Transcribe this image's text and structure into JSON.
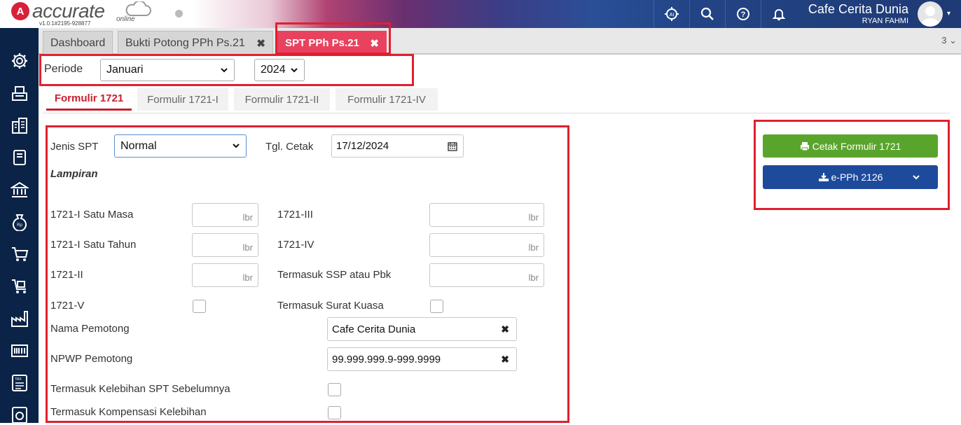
{
  "app": {
    "logo_letter": "A",
    "name": "accurate",
    "online": "online",
    "version": "v1.0.1#2195-928877"
  },
  "header": {
    "company": "Cafe Cerita Dunia",
    "user": "RYAN FAHMI",
    "icons": [
      "ai-icon",
      "search-icon",
      "help-icon",
      "bell-icon"
    ]
  },
  "sidebar": {
    "icons": [
      "gear-icon",
      "cash-register-icon",
      "building-icon",
      "book-icon",
      "bank-icon",
      "money-bag-icon",
      "cart-icon",
      "cart-box-icon",
      "factory-icon",
      "barcode-icon",
      "tax-icon",
      "report-icon"
    ]
  },
  "tabs": [
    {
      "label": "Dashboard"
    },
    {
      "label": "Bukti Potong PPh Ps.21",
      "close": "✖"
    },
    {
      "label": "SPT PPh Ps.21",
      "close": "✖"
    }
  ],
  "tab_count": "3",
  "periode": {
    "label": "Periode",
    "month": "Januari",
    "year": "2024"
  },
  "subtabs": [
    "Formulir 1721",
    "Formulir 1721-I",
    "Formulir 1721-II",
    "Formulir 1721-IV"
  ],
  "form": {
    "jenis_spt_label": "Jenis SPT",
    "jenis_spt_value": "Normal",
    "tgl_cetak_label": "Tgl. Cetak",
    "tgl_cetak_value": "17/12/2024",
    "lampiran_label": "Lampiran",
    "unit": "lbr",
    "satu_masa_label": "1721-I Satu Masa",
    "satu_tahun_label": "1721-I Satu Tahun",
    "ii_label": "1721-II",
    "iii_label": "1721-III",
    "iv_label": "1721-IV",
    "ssp_label": "Termasuk SSP atau Pbk",
    "v_label": "1721-V",
    "surat_kuasa_label": "Termasuk Surat Kuasa",
    "nama_pemotong_label": "Nama Pemotong",
    "nama_pemotong_value": "Cafe Cerita Dunia",
    "npwp_label": "NPWP Pemotong",
    "npwp_value": "99.999.999.9-999.9999",
    "kelebihan_label": "Termasuk Kelebihan SPT Sebelumnya",
    "kompensasi_label": "Termasuk Kompensasi Kelebihan",
    "clear": "✖"
  },
  "actions": {
    "cetak_label": "Cetak Formulir 1721",
    "epph_label": "e-PPh 2126"
  },
  "colors": {
    "sidebar": "#0b2347",
    "tab_active": "#e8425f",
    "highlight": "#e0202e",
    "green": "#59a52c",
    "blue": "#1e4a9c"
  }
}
